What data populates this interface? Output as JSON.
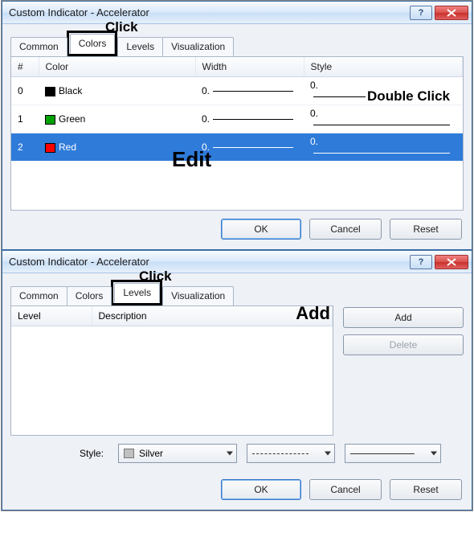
{
  "dialog1": {
    "title": "Custom Indicator - Accelerator",
    "anno_click": "Click",
    "tabs": {
      "common": "Common",
      "colors": "Colors",
      "levels": "Levels",
      "visualization": "Visualization"
    },
    "cols": {
      "num": "#",
      "color": "Color",
      "width": "Width",
      "style": "Style"
    },
    "rows": [
      {
        "n": "0",
        "name": "Black",
        "swatch": "#000000",
        "width": "0.",
        "style": "0."
      },
      {
        "n": "1",
        "name": "Green",
        "swatch": "#00a000",
        "width": "0.",
        "style": "0."
      },
      {
        "n": "2",
        "name": "Red",
        "swatch": "#ff0000",
        "width": "0.",
        "style": "0."
      }
    ],
    "anno_dbl": "Double Click",
    "anno_edit": "Edit",
    "buttons": {
      "ok": "OK",
      "cancel": "Cancel",
      "reset": "Reset"
    }
  },
  "dialog2": {
    "title": "Custom Indicator - Accelerator",
    "anno_click": "Click",
    "tabs": {
      "common": "Common",
      "colors": "Colors",
      "levels": "Levels",
      "visualization": "Visualization"
    },
    "cols": {
      "level": "Level",
      "desc": "Description"
    },
    "buttons": {
      "add": "Add",
      "delete": "Delete"
    },
    "anno_add": "Add",
    "style_label": "Style:",
    "style_value": "Silver",
    "footer": {
      "ok": "OK",
      "cancel": "Cancel",
      "reset": "Reset"
    }
  }
}
